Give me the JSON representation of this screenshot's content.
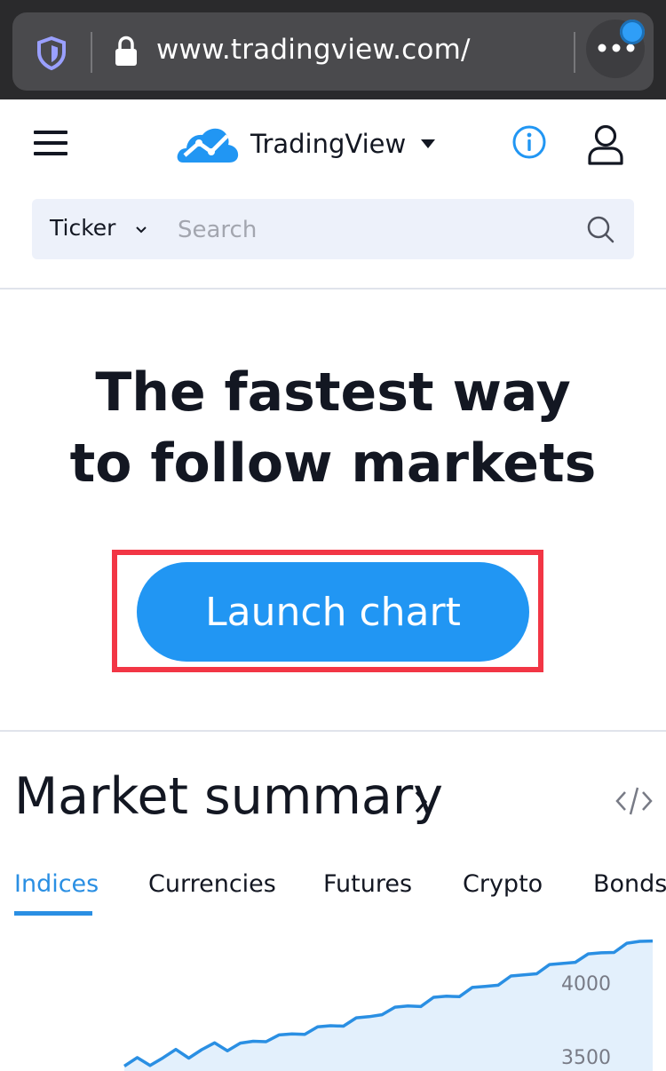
{
  "browser": {
    "url": "www.tradingview.com/",
    "icons": [
      "shield-icon",
      "lock-icon",
      "more-icon"
    ]
  },
  "header": {
    "brand": "TradingView",
    "icons": [
      "hamburger-icon",
      "tradingview-logo-icon",
      "caret-down-icon",
      "info-icon",
      "user-icon"
    ],
    "brand_color": "#2196f3"
  },
  "search": {
    "ticker_label": "Ticker",
    "placeholder": "Search"
  },
  "hero": {
    "line1": "The fastest way",
    "line2": "to follow markets",
    "cta_label": "Launch chart",
    "cta_color": "#2196f3",
    "highlight_color": "#f23645"
  },
  "market_summary": {
    "title": "Market summary",
    "tabs": [
      {
        "label": "Indices",
        "active": true
      },
      {
        "label": "Currencies",
        "active": false
      },
      {
        "label": "Futures",
        "active": false
      },
      {
        "label": "Crypto",
        "active": false
      },
      {
        "label": "Bonds",
        "active": false
      }
    ],
    "active_color": "#2a8fe3"
  },
  "chart_data": {
    "type": "area",
    "title": "",
    "xlabel": "",
    "ylabel": "",
    "y_ticks": [
      "4000",
      "3500"
    ],
    "series": [
      {
        "values": [
          3280,
          3310,
          3300,
          3330,
          3360,
          3345,
          3380,
          3400,
          3390,
          3420,
          3410,
          3445,
          3470,
          3455,
          3490,
          3520,
          3505,
          3540,
          3575,
          3560,
          3610,
          3640,
          3625,
          3660,
          3700,
          3685,
          3720,
          3760,
          3745,
          3790,
          3830,
          3815,
          3860,
          3900,
          3885,
          3930,
          3965,
          3950,
          3990,
          4030,
          4020,
          4060
        ]
      }
    ],
    "ylim": [
      3250,
      4150
    ],
    "line_color": "#2a8fe3",
    "fill_color": "#e3f0fc"
  }
}
